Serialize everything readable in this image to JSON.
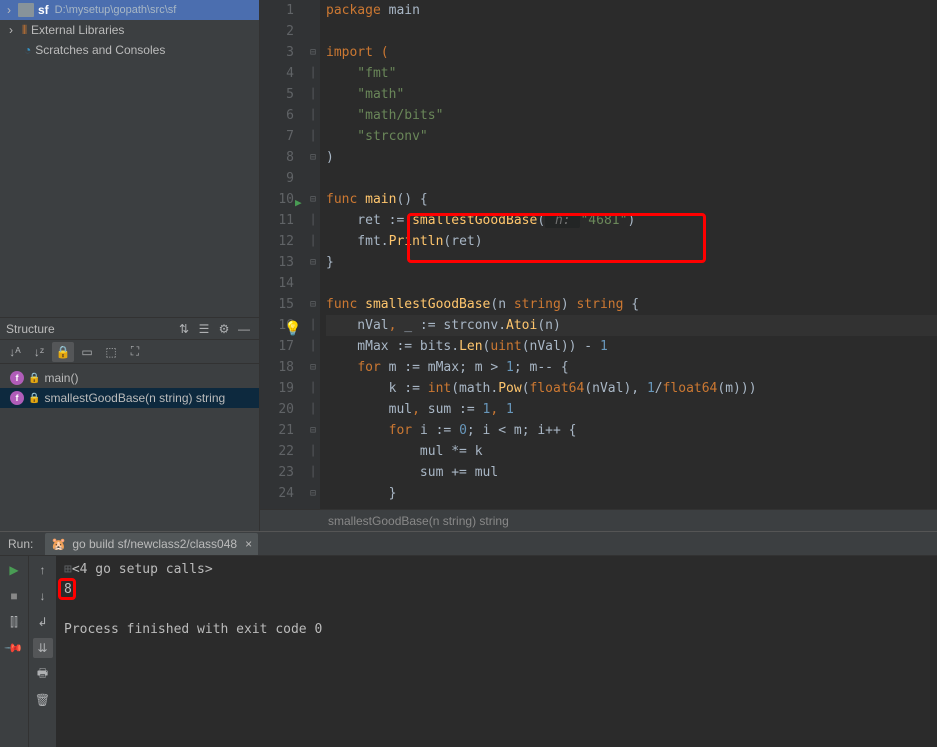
{
  "project": {
    "name": "sf",
    "path": "D:\\mysetup\\gopath\\src\\sf",
    "external_libs": "External Libraries",
    "scratches": "Scratches and Consoles"
  },
  "structure": {
    "title": "Structure",
    "items": [
      {
        "label": "main()"
      },
      {
        "label": "smallestGoodBase(n string) string"
      }
    ]
  },
  "editor": {
    "lines": [
      1,
      2,
      3,
      4,
      5,
      6,
      7,
      8,
      9,
      10,
      11,
      12,
      13,
      14,
      15,
      16,
      17,
      18,
      19,
      20,
      21,
      22,
      23,
      24
    ],
    "breadcrumb": "smallestGoodBase(n string) string"
  },
  "code": {
    "l1_a": "package ",
    "l1_b": "main",
    "l3": "import (",
    "l4": "    \"fmt\"",
    "l5": "    \"math\"",
    "l6": "    \"math/bits\"",
    "l7": "    \"strconv\"",
    "l8": ")",
    "l10a": "func ",
    "l10b": "main",
    "l10c": "() {",
    "l11a": "    ret := ",
    "l11b": "smallestGoodBase",
    "l11c": "(",
    "l11p": " n: ",
    "l11d": "\"4681\"",
    "l11e": ")",
    "l12a": "    fmt.",
    "l12b": "Println",
    "l12c": "(ret)",
    "l13": "}",
    "l15a": "func ",
    "l15b": "smallestGoodBase",
    "l15c": "(n ",
    "l15d": "string",
    "l15e": ") ",
    "l15f": "string",
    "l15g": " {",
    "l16a": "    nVal",
    "l16b": ", ",
    "l16c": "_",
    "l16d": " := strconv.",
    "l16e": "Atoi",
    "l16f": "(n)",
    "l17a": "    mMax := bits.",
    "l17b": "Len",
    "l17c": "(",
    "l17d": "uint",
    "l17e": "(nVal)) - ",
    "l17f": "1",
    "l18a": "    ",
    "l18b": "for ",
    "l18c": "m := mMax; m > ",
    "l18d": "1",
    "l18e": "; m-- {",
    "l19a": "        k := ",
    "l19b": "int",
    "l19c": "(math.",
    "l19d": "Pow",
    "l19e": "(",
    "l19f": "float64",
    "l19g": "(nVal), ",
    "l19h": "1",
    "l19i": "/",
    "l19j": "float64",
    "l19k": "(m)))",
    "l20a": "        mul",
    "l20b": ", ",
    "l20c": "sum",
    "l20d": " := ",
    "l20e": "1",
    "l20f": ", ",
    "l20g": "1",
    "l21a": "        ",
    "l21b": "for ",
    "l21c": "i := ",
    "l21d": "0",
    "l21e": "; i < m; i++ {",
    "l22": "            mul *= k",
    "l23": "            sum += mul",
    "l24": "        }"
  },
  "run": {
    "label": "Run:",
    "tab": "go build sf/newclass2/class048",
    "out1": "<4 go setup calls>",
    "out2": "8",
    "out3": "Process finished with exit code 0"
  }
}
